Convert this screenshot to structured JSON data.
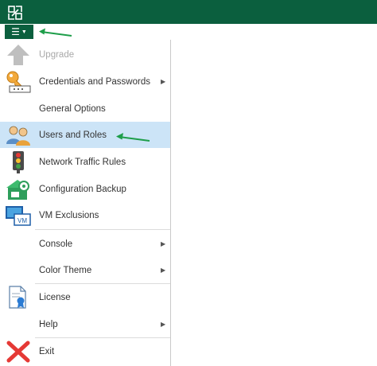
{
  "toolbar": {
    "menu_icon": "hamburger-menu-icon"
  },
  "menu": {
    "items": [
      {
        "label": "Upgrade",
        "icon": "upgrade-arrow-icon",
        "disabled": true
      },
      {
        "label": "Credentials and Passwords",
        "icon": "key-icon",
        "submenu": true
      },
      {
        "label": "General Options"
      },
      {
        "label": "Users and Roles",
        "icon": "users-icon",
        "selected": true
      },
      {
        "label": "Network Traffic Rules",
        "icon": "traffic-light-icon"
      },
      {
        "label": "Configuration Backup",
        "icon": "config-backup-icon"
      },
      {
        "label": "VM Exclusions",
        "icon": "vm-monitor-icon"
      },
      {
        "label": "Console",
        "submenu": true
      },
      {
        "label": "Color Theme",
        "submenu": true
      },
      {
        "label": "License",
        "icon": "license-certificate-icon"
      },
      {
        "label": "Help",
        "submenu": true
      },
      {
        "label": "Exit",
        "icon": "exit-x-icon"
      }
    ],
    "vm_badge": "VM"
  },
  "colors": {
    "title_bar": "#0b5f3e",
    "selected_item": "#cce4f7",
    "annotation_arrow": "#1e9e4a"
  }
}
